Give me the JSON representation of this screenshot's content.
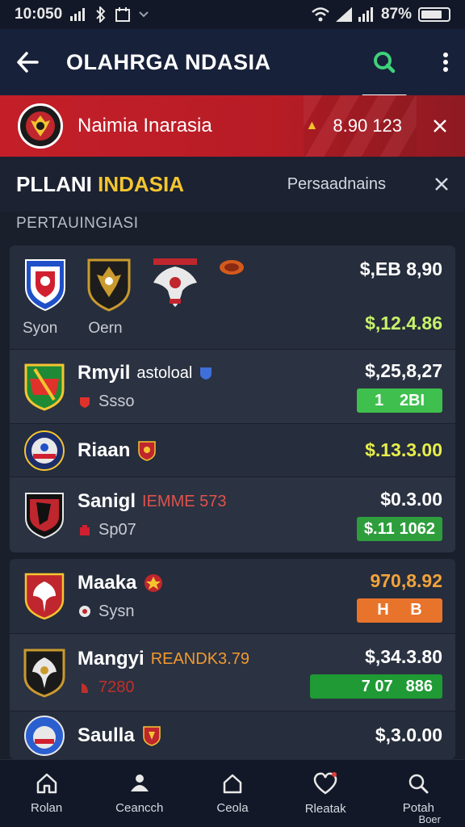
{
  "status_bar": {
    "time": "10:050",
    "battery": "87%"
  },
  "app_bar": {
    "title": "OLAHRGA NDASIA"
  },
  "banner": {
    "title": "Naimia Inarasia",
    "price": "8.90 123"
  },
  "section": {
    "title_main": "PLLANI ",
    "title_accent": "INDASIA",
    "link": "Persaadnains",
    "subhead": "PERTAUINGIASI"
  },
  "cards": [
    {
      "rows": [
        {
          "type": "multi",
          "labels": [
            "Syon",
            "Oern"
          ],
          "price_top": "$,EB 8,90",
          "price_bottom": "$,12.4.86",
          "price_bottom_color": "#c6f26a"
        },
        {
          "name": "Rmyil",
          "tag": "astoloal",
          "tag_color": "#ffffff",
          "sub": "Ssso",
          "price": "$,25,8,27",
          "price_color": "#ffffff",
          "pill_left": "1",
          "pill_right": "2BI",
          "pill_color": "#3fbf4e",
          "crest": "green"
        },
        {
          "name": "Riaan",
          "price": "$.13.3.00",
          "price_color": "#e6ee4a",
          "crest": "blue"
        },
        {
          "name": "Sanigl",
          "tag": "IEMME 573",
          "tag_color": "#e0524a",
          "sub": "Sp07",
          "price": "$0.3.00",
          "price_color": "#ffffff",
          "pill_left": "$.11",
          "pill_right": "1062",
          "pill_color": "#2e9e3d",
          "crest": "red"
        }
      ]
    },
    {
      "rows": [
        {
          "name": "Maaka",
          "sub": "Sysn",
          "price": "970,8.92",
          "price_color": "#f2a33a",
          "pill_left": "H",
          "pill_right": "B",
          "pill_color": "#e8742c",
          "crest": "redwhite"
        },
        {
          "name": "Mangyi",
          "tag": "REANDK3.79",
          "tag_color": "#f29a2e",
          "sub": "7280",
          "sub_color": "#c0302a",
          "price": "$,34.3.80",
          "price_color": "#ffffff",
          "pill_left": "7 07",
          "pill_right": "886",
          "pill_color": "#1f9a35",
          "crest": "garuda"
        },
        {
          "name": "Saulla",
          "price": "$,3.0.00",
          "price_color": "#ffffff",
          "crest": "blue"
        }
      ]
    }
  ],
  "bottom_nav": [
    {
      "label": "Rolan",
      "icon": "home-icon"
    },
    {
      "label": "Ceancch",
      "icon": "people-icon"
    },
    {
      "label": "Ceola",
      "icon": "house-icon"
    },
    {
      "label": "Rleatak",
      "icon": "heart-icon"
    },
    {
      "label": "Potah",
      "icon": "search-icon"
    }
  ],
  "bottom_nav_extra": "Boer",
  "colors": {
    "accent_yellow": "#f4c531",
    "banner_red": "#c41f29",
    "search_green": "#3fd17a"
  }
}
